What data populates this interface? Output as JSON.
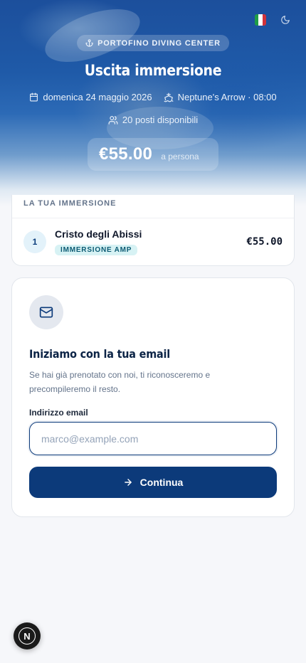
{
  "hero": {
    "badge": "PORTOFINO DIVING CENTER",
    "title": "Uscita immersione",
    "date": "domenica 24 maggio 2026",
    "boat_time": "Neptune's Arrow · 08:00",
    "spots": "20 posti disponibili",
    "price": "€55.00",
    "price_unit": "a persona",
    "icons": {
      "badge": "anchor-icon",
      "date": "calendar-icon",
      "boat": "ship-icon",
      "spots": "users-icon",
      "language": "italy-flag-icon",
      "theme": "moon-icon"
    }
  },
  "summary": {
    "header": "LA TUA IMMERSIONE",
    "items": [
      {
        "index": "1",
        "name": "Cristo degli Abissi",
        "tag": "IMMERSIONE AMP",
        "price": "€55.00"
      }
    ]
  },
  "email_step": {
    "icon": "mail-icon",
    "title": "Iniziamo con la tua email",
    "subtitle": "Se hai già prenotato con noi, ti riconosceremo e precompileremo il resto.",
    "label": "Indirizzo email",
    "placeholder": "marco@example.com",
    "value": "",
    "button_label": "Continua",
    "button_icon": "arrow-right-icon"
  },
  "fab": {
    "label": "N"
  },
  "colors": {
    "primary": "#0c3a7a",
    "tag_bg": "#d7f2f4",
    "step_bg": "#e3f2fa",
    "page_bg": "#f6f7fa"
  }
}
